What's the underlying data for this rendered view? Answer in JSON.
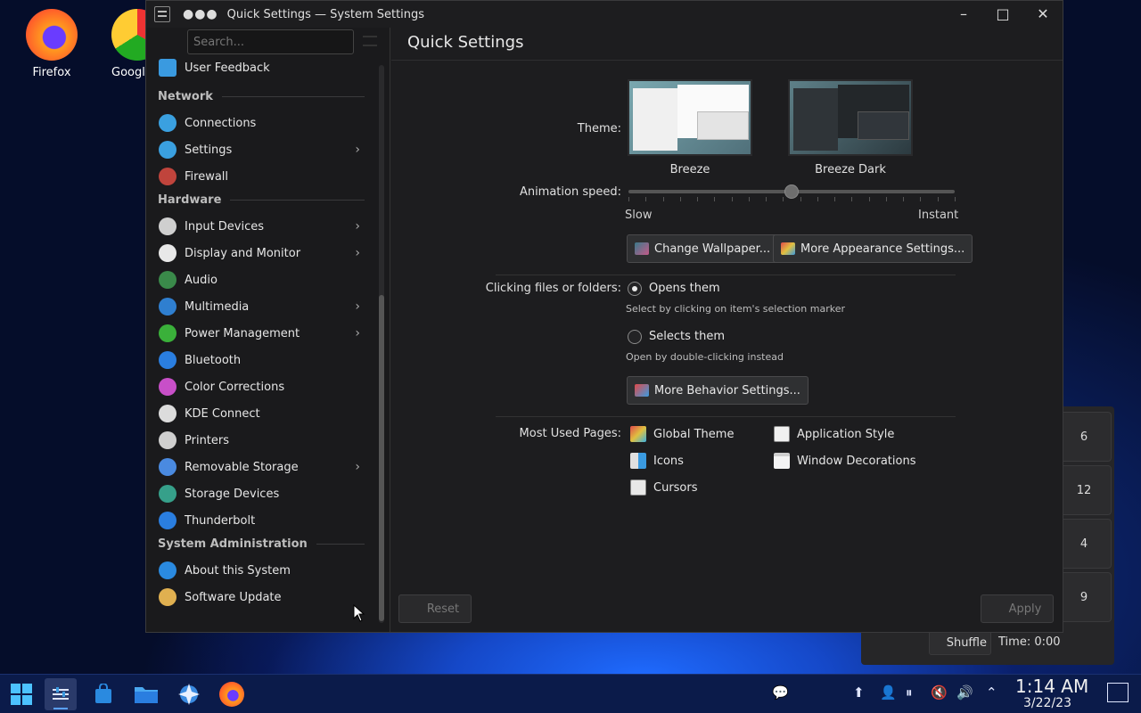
{
  "desktop": {
    "icons": [
      {
        "label": "Firefox"
      },
      {
        "label": "Google"
      }
    ]
  },
  "window": {
    "title": "Quick Settings — System Settings",
    "dots": "●●●",
    "controls": {
      "minimize": "–",
      "maximize": "□",
      "close": "✕"
    }
  },
  "sidebar": {
    "search_placeholder": "Search...",
    "top_item": "User Feedback",
    "sections": [
      {
        "header": "Network",
        "items": [
          {
            "label": "Connections",
            "icon": "connections-icon",
            "color": "#3aa0e0",
            "chevron": false
          },
          {
            "label": "Settings",
            "icon": "network-settings-icon",
            "color": "#3aa0e0",
            "chevron": true
          },
          {
            "label": "Firewall",
            "icon": "firewall-icon",
            "color": "#c0443c",
            "chevron": false
          }
        ]
      },
      {
        "header": "Hardware",
        "items": [
          {
            "label": "Input Devices",
            "icon": "mouse-icon",
            "color": "#cfcfcf",
            "chevron": true
          },
          {
            "label": "Display and Monitor",
            "icon": "monitor-icon",
            "color": "#e8e8e8",
            "chevron": true
          },
          {
            "label": "Audio",
            "icon": "speaker-icon",
            "color": "#3a8a4a",
            "chevron": false
          },
          {
            "label": "Multimedia",
            "icon": "multimedia-icon",
            "color": "#2f7fd0",
            "chevron": true
          },
          {
            "label": "Power Management",
            "icon": "power-icon",
            "color": "#3ab03a",
            "chevron": true
          },
          {
            "label": "Bluetooth",
            "icon": "bluetooth-icon",
            "color": "#2a7ee0",
            "chevron": false
          },
          {
            "label": "Color Corrections",
            "icon": "color-wheel-icon",
            "color": "#c84fc8",
            "chevron": false
          },
          {
            "label": "KDE Connect",
            "icon": "phone-icon",
            "color": "#dcdcdc",
            "chevron": false
          },
          {
            "label": "Printers",
            "icon": "printer-icon",
            "color": "#cfcfcf",
            "chevron": false
          },
          {
            "label": "Removable Storage",
            "icon": "usb-icon",
            "color": "#4a8ae0",
            "chevron": true
          },
          {
            "label": "Storage Devices",
            "icon": "storage-icon",
            "color": "#36a08a",
            "chevron": false
          },
          {
            "label": "Thunderbolt",
            "icon": "thunderbolt-icon",
            "color": "#2a7ee0",
            "chevron": false
          }
        ]
      },
      {
        "header": "System Administration",
        "items": [
          {
            "label": "About this System",
            "icon": "info-icon",
            "color": "#2a8ae0",
            "chevron": false
          },
          {
            "label": "Software Update",
            "icon": "update-icon",
            "color": "#e0b050",
            "chevron": false
          }
        ]
      }
    ]
  },
  "main": {
    "title": "Quick Settings",
    "theme_label": "Theme:",
    "themes": [
      {
        "name": "Breeze",
        "variant": "light"
      },
      {
        "name": "Breeze Dark",
        "variant": "dark"
      }
    ],
    "animation_label": "Animation speed:",
    "slider_min": "Slow",
    "slider_max": "Instant",
    "slider_value": 0.5,
    "change_wallpaper": "Change Wallpaper...",
    "more_appearance": "More Appearance Settings...",
    "clicking_label": "Clicking files or folders:",
    "option_open": "Opens them",
    "option_open_hint": "Select by clicking on item's selection marker",
    "option_select": "Selects them",
    "option_select_hint": "Open by double-clicking instead",
    "more_behavior": "More Behavior Settings...",
    "most_used_label": "Most Used Pages:",
    "most_used": [
      {
        "label": "Global Theme",
        "icon": "global-theme-icon"
      },
      {
        "label": "Application Style",
        "icon": "app-style-icon"
      },
      {
        "label": "Icons",
        "icon": "icons-icon"
      },
      {
        "label": "Window Decorations",
        "icon": "window-decorations-icon"
      },
      {
        "label": "Cursors",
        "icon": "cursors-icon"
      }
    ],
    "reset": "Reset",
    "apply": "Apply"
  },
  "background_widget": {
    "tiles": [
      "6",
      "12",
      "4",
      "9"
    ],
    "shuffle": "Shuffle",
    "time": "Time: 0:00"
  },
  "taskbar": {
    "clock_time": "1:14 AM",
    "clock_date": "3/22/23"
  }
}
